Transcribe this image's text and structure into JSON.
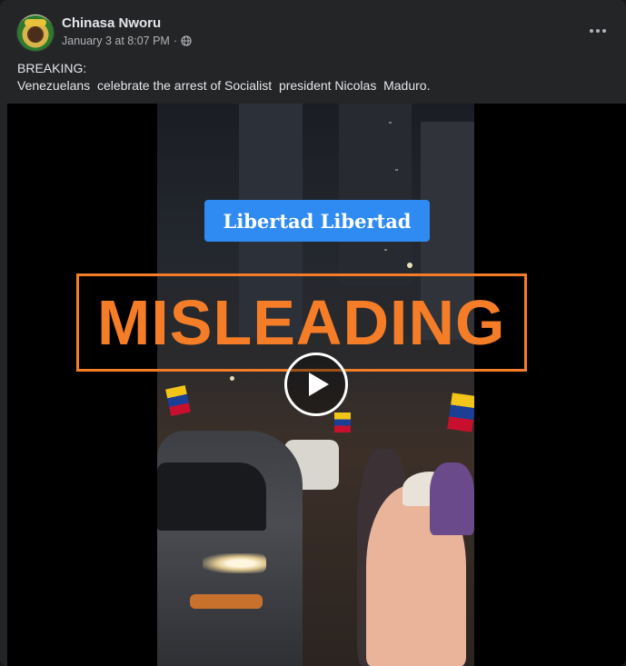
{
  "post": {
    "author": "Chinasa Nworu",
    "timestamp": "January 3 at 8:07 PM",
    "separator": "·",
    "privacy_icon": "globe-icon",
    "more_icon": "more-options-icon",
    "text_lines": [
      "BREAKING:",
      "Venezuelans  celebrate the arrest of Socialist  president Nicolas  Maduro."
    ]
  },
  "video": {
    "caption": "Libertad Libertad",
    "overlay_stamp": "MISLEADING",
    "play_icon": "play-icon"
  },
  "colors": {
    "background": "#242526",
    "text_primary": "#e4e6eb",
    "text_secondary": "#b0b3b8",
    "caption_chip": "#2f8bf2",
    "misleading": "#f57d28"
  }
}
